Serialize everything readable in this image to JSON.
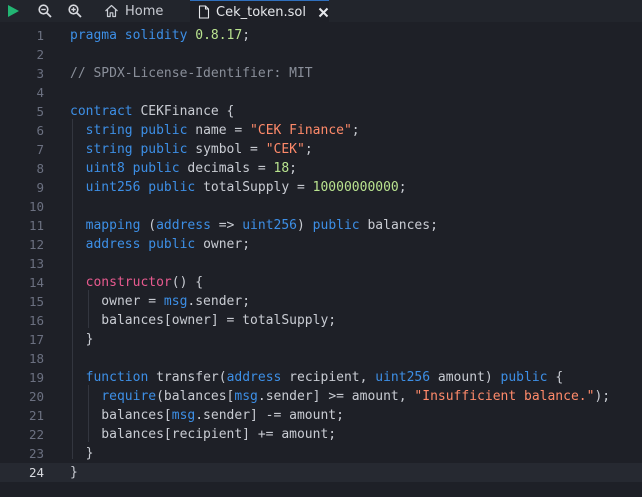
{
  "toolbar": {
    "run_icon": "play-icon",
    "zoom_out_icon": "zoom-out-icon",
    "zoom_in_icon": "zoom-in-icon"
  },
  "tabs": [
    {
      "label": "Home",
      "icon": "home-icon",
      "active": false
    },
    {
      "label": "Cek_token.sol",
      "icon": "file-icon",
      "active": true,
      "close_icon": "close-icon"
    }
  ],
  "editor": {
    "active_line": 24,
    "lines": [
      {
        "n": "1",
        "tokens": [
          [
            "kw",
            "pragma"
          ],
          [
            "tx",
            " "
          ],
          [
            "kw",
            "solidity"
          ],
          [
            "tx",
            " "
          ],
          [
            "num",
            "0.8.17"
          ],
          [
            "pu",
            ";"
          ]
        ]
      },
      {
        "n": "2",
        "tokens": []
      },
      {
        "n": "3",
        "tokens": [
          [
            "cm",
            "// SPDX-License-Identifier: MIT"
          ]
        ]
      },
      {
        "n": "4",
        "tokens": []
      },
      {
        "n": "5",
        "tokens": [
          [
            "kw",
            "contract"
          ],
          [
            "tx",
            " CEKFinance {"
          ]
        ]
      },
      {
        "n": "6",
        "tokens": [
          [
            "tx",
            "  "
          ],
          [
            "ty",
            "string"
          ],
          [
            "tx",
            " "
          ],
          [
            "kw",
            "public"
          ],
          [
            "tx",
            " name = "
          ],
          [
            "str",
            "\"CEK Finance\""
          ],
          [
            "pu",
            ";"
          ]
        ]
      },
      {
        "n": "7",
        "tokens": [
          [
            "tx",
            "  "
          ],
          [
            "ty",
            "string"
          ],
          [
            "tx",
            " "
          ],
          [
            "kw",
            "public"
          ],
          [
            "tx",
            " symbol = "
          ],
          [
            "str",
            "\"CEK\""
          ],
          [
            "pu",
            ";"
          ]
        ]
      },
      {
        "n": "8",
        "tokens": [
          [
            "tx",
            "  "
          ],
          [
            "ty",
            "uint8"
          ],
          [
            "tx",
            " "
          ],
          [
            "kw",
            "public"
          ],
          [
            "tx",
            " decimals = "
          ],
          [
            "num",
            "18"
          ],
          [
            "pu",
            ";"
          ]
        ]
      },
      {
        "n": "9",
        "tokens": [
          [
            "tx",
            "  "
          ],
          [
            "ty",
            "uint256"
          ],
          [
            "tx",
            " "
          ],
          [
            "kw",
            "public"
          ],
          [
            "tx",
            " totalSupply = "
          ],
          [
            "num",
            "10000000000"
          ],
          [
            "pu",
            ";"
          ]
        ]
      },
      {
        "n": "10",
        "tokens": []
      },
      {
        "n": "11",
        "tokens": [
          [
            "tx",
            "  "
          ],
          [
            "kw",
            "mapping"
          ],
          [
            "tx",
            " ("
          ],
          [
            "ty",
            "address"
          ],
          [
            "tx",
            " => "
          ],
          [
            "ty",
            "uint256"
          ],
          [
            "tx",
            ") "
          ],
          [
            "kw",
            "public"
          ],
          [
            "tx",
            " balances;"
          ]
        ]
      },
      {
        "n": "12",
        "tokens": [
          [
            "tx",
            "  "
          ],
          [
            "ty",
            "address"
          ],
          [
            "tx",
            " "
          ],
          [
            "kw",
            "public"
          ],
          [
            "tx",
            " owner;"
          ]
        ]
      },
      {
        "n": "13",
        "tokens": []
      },
      {
        "n": "14",
        "tokens": [
          [
            "tx",
            "  "
          ],
          [
            "fn",
            "constructor"
          ],
          [
            "tx",
            "() {"
          ]
        ]
      },
      {
        "n": "15",
        "tokens": [
          [
            "tx",
            "    owner = "
          ],
          [
            "kw",
            "msg"
          ],
          [
            "tx",
            ".sender;"
          ]
        ]
      },
      {
        "n": "16",
        "tokens": [
          [
            "tx",
            "    balances[owner] = totalSupply;"
          ]
        ]
      },
      {
        "n": "17",
        "tokens": [
          [
            "tx",
            "  }"
          ]
        ]
      },
      {
        "n": "18",
        "tokens": []
      },
      {
        "n": "19",
        "tokens": [
          [
            "tx",
            "  "
          ],
          [
            "kw",
            "function"
          ],
          [
            "tx",
            " transfer("
          ],
          [
            "ty",
            "address"
          ],
          [
            "tx",
            " recipient, "
          ],
          [
            "ty",
            "uint256"
          ],
          [
            "tx",
            " amount) "
          ],
          [
            "kw",
            "public"
          ],
          [
            "tx",
            " {"
          ]
        ]
      },
      {
        "n": "20",
        "tokens": [
          [
            "tx",
            "    "
          ],
          [
            "kw",
            "require"
          ],
          [
            "tx",
            "(balances["
          ],
          [
            "kw",
            "msg"
          ],
          [
            "tx",
            ".sender] >= amount, "
          ],
          [
            "str",
            "\"Insufficient balance.\""
          ],
          [
            "tx",
            ");"
          ]
        ]
      },
      {
        "n": "21",
        "tokens": [
          [
            "tx",
            "    balances["
          ],
          [
            "kw",
            "msg"
          ],
          [
            "tx",
            ".sender] -= amount;"
          ]
        ]
      },
      {
        "n": "22",
        "tokens": [
          [
            "tx",
            "    balances[recipient] += amount;"
          ]
        ]
      },
      {
        "n": "23",
        "tokens": [
          [
            "tx",
            "  }"
          ]
        ]
      },
      {
        "n": "24",
        "tokens": [
          [
            "tx",
            "}"
          ]
        ]
      }
    ]
  },
  "colors": {
    "background": "#1e2027",
    "keyword": "#3d8fe6",
    "function_name": "#e85a8f",
    "string": "#ff8a6a",
    "number": "#b9e38f",
    "comment": "#8a8f9a",
    "run_button": "#22b573"
  }
}
